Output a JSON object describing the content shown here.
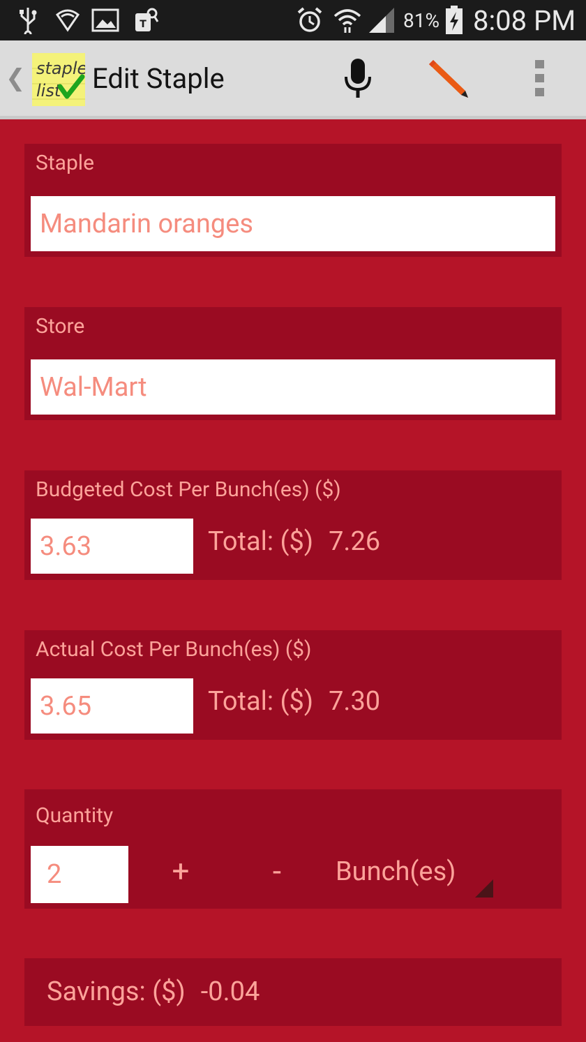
{
  "status_bar": {
    "icons": [
      "usb-icon",
      "shield-icon",
      "image-icon",
      "tmobile-icon",
      "alarm-icon",
      "wifi-icon",
      "signal-icon",
      "battery-charging-icon"
    ],
    "battery": "81%",
    "time": "8:08 PM"
  },
  "action_bar": {
    "title": "Edit Staple",
    "logo_text_line1": "staple",
    "logo_text_line2": "list",
    "icons": [
      "back-chevron-icon",
      "microphone-icon",
      "pencil-icon",
      "overflow-menu-icon"
    ]
  },
  "staple": {
    "label": "Staple",
    "value": "Mandarin oranges"
  },
  "store": {
    "label": "Store",
    "value": "Wal-Mart"
  },
  "budgeted": {
    "label": "Budgeted Cost Per Bunch(es) ($)",
    "value": "3.63",
    "total_label": "Total: ($)",
    "total_value": "7.26"
  },
  "actual": {
    "label": "Actual Cost Per Bunch(es) ($)",
    "value": "3.65",
    "total_label": "Total: ($)",
    "total_value": "7.30"
  },
  "quantity": {
    "label": "Quantity",
    "value": "2",
    "plus_label": "+",
    "minus_label": "-",
    "unit": "Bunch(es)"
  },
  "savings": {
    "label": "Savings: ($)",
    "value": "-0.04"
  },
  "colors": {
    "background": "#b51428",
    "card": "#9a0b22",
    "label_text": "#fca39a",
    "input_text": "#f58c7e",
    "action_bar": "#dcdcdc"
  }
}
